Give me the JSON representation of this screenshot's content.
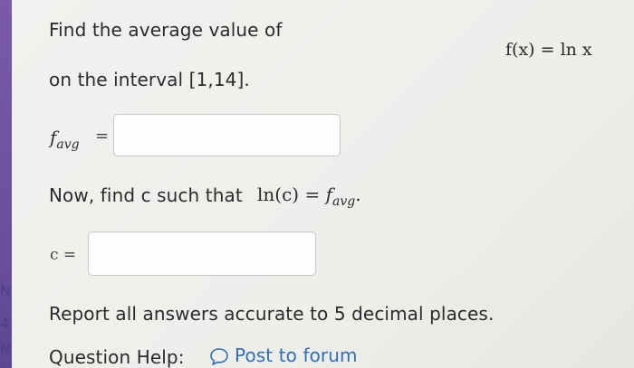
{
  "question": {
    "prompt_line1": "Find the average value of",
    "function_display": "f(x) = ln x",
    "interval_line": "on the interval [1,14].",
    "favg_label": "f",
    "favg_subscript": "avg",
    "equals_sign": "=",
    "favg_input_value": "",
    "second_prompt": "Now, find c such that",
    "second_math_ln": "ln(c)",
    "second_math_eq": "=",
    "second_math_f": "f",
    "second_math_sub": "avg",
    "second_math_end": ".",
    "c_label": "c =",
    "c_input_value": ""
  },
  "footer": {
    "report_text": "Report all answers accurate to 5 decimal places.",
    "help_label": "Question Help:",
    "post_to_forum": "Post to forum"
  },
  "left_strip_glyphs": [
    "N",
    "4",
    "N"
  ]
}
